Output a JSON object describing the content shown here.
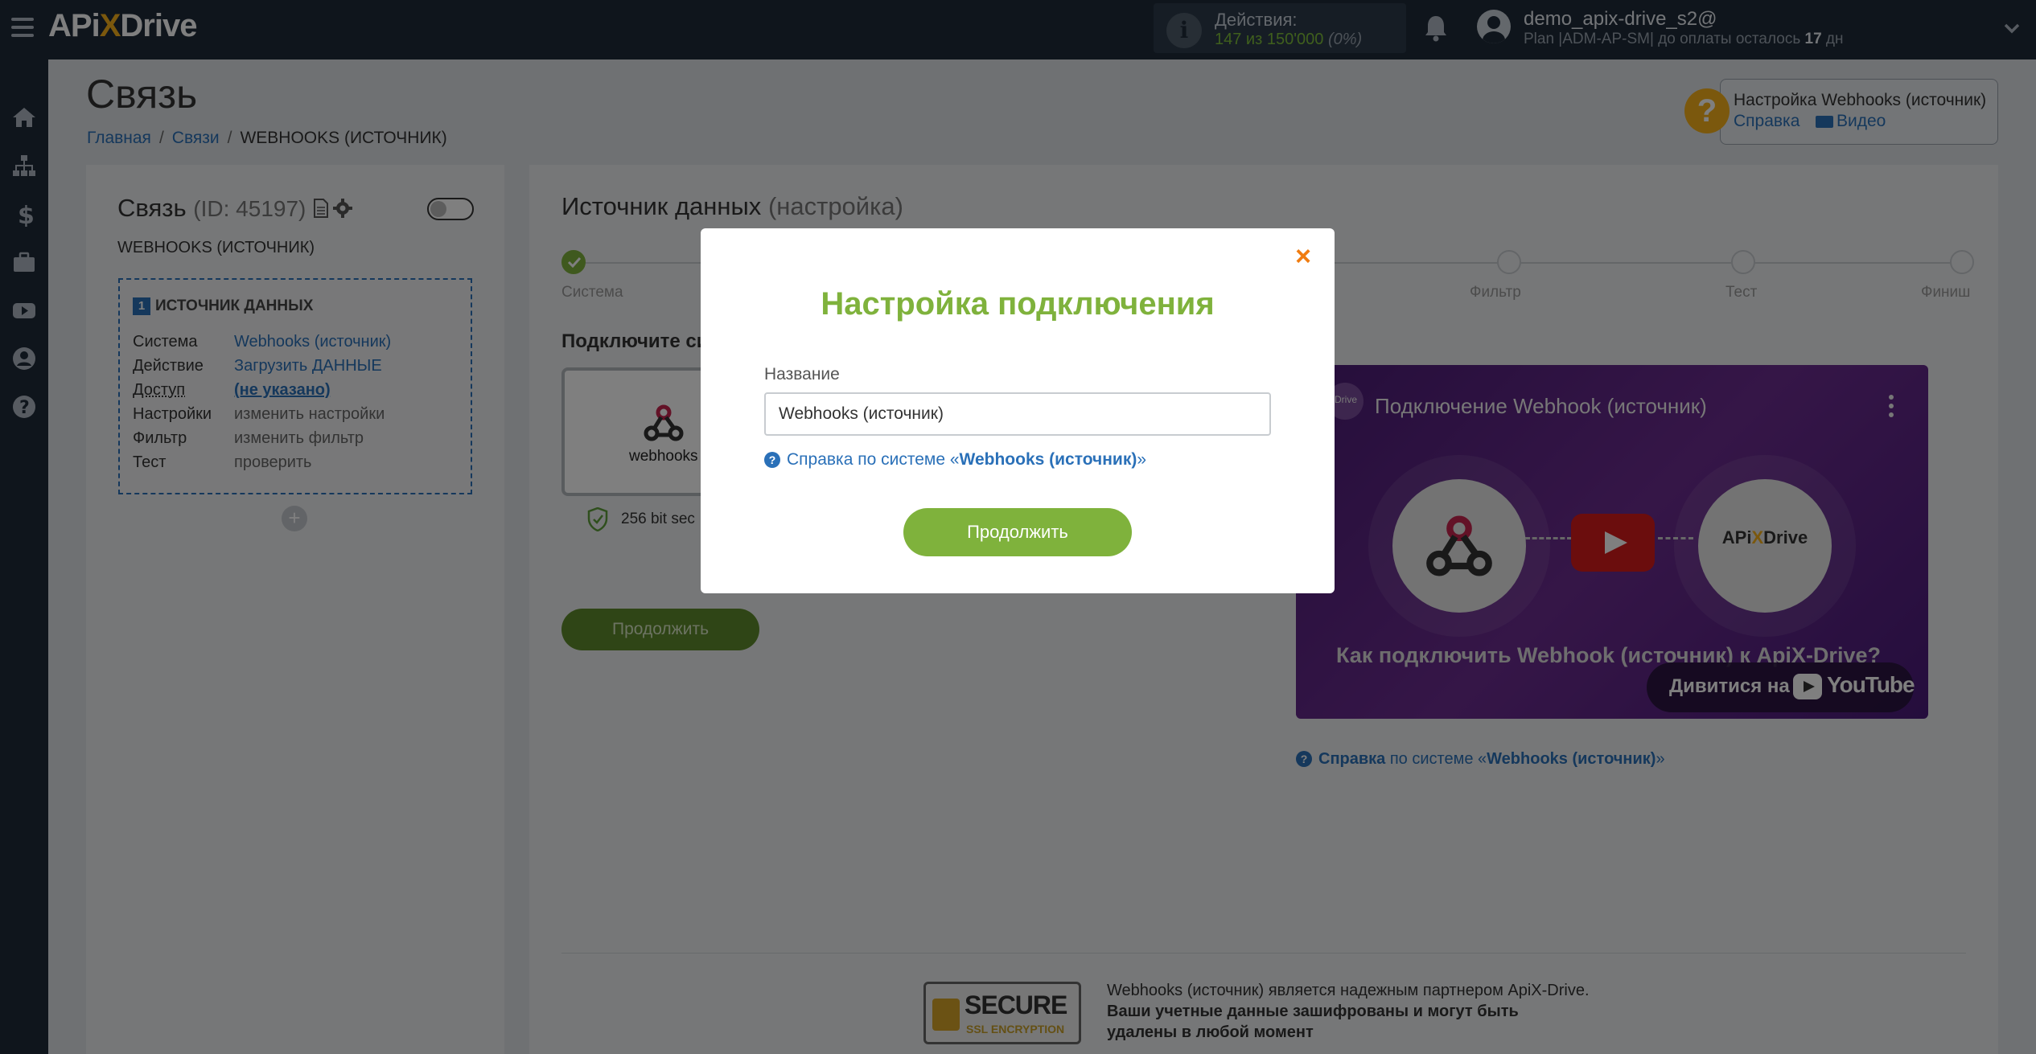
{
  "app": {
    "logo_left": "APi",
    "logo_x": "X",
    "logo_right": "Drive"
  },
  "header": {
    "actions_label": "Действия:",
    "actions_used": "147",
    "actions_mid": " из ",
    "actions_total": "150'000",
    "actions_percent": "(0%)",
    "user_name": "demo_apix-drive_s2@",
    "plan_prefix": "Plan |ADM-AP-SM| до оплаты осталось ",
    "plan_days": "17",
    "plan_suffix": " дн"
  },
  "sidebar": {
    "icons": [
      "home-icon",
      "sitemap-icon",
      "dollar-icon",
      "briefcase-icon",
      "youtube-icon",
      "user-icon",
      "question-icon"
    ]
  },
  "page": {
    "title": "Связь",
    "breadcrumb": {
      "home": "Главная",
      "links": "Связи",
      "current": "WEBHOOKS (ИСТОЧНИК)"
    },
    "help": {
      "title": "Настройка Webhooks (источник)",
      "ref": "Справка",
      "video": "Видео"
    }
  },
  "connection": {
    "title": "Связь",
    "id": "(ID: 45197)",
    "subtitle": "WEBHOOKS (ИСТОЧНИК)",
    "source": {
      "number": "1",
      "heading": "ИСТОЧНИК ДАННЫХ",
      "rows": [
        {
          "key": "Система",
          "value": "Webhooks (источник)"
        },
        {
          "key": "Действие",
          "value": "Загрузить ДАННЫЕ"
        },
        {
          "key": "Доступ",
          "value": "(не указано)"
        },
        {
          "key": "Настройки",
          "value": "изменить настройки"
        },
        {
          "key": "Фильтр",
          "value": "изменить фильтр"
        },
        {
          "key": "Тест",
          "value": "проверить"
        }
      ]
    },
    "add_symbol": "+"
  },
  "main": {
    "title": "Источник данных",
    "title_suffix": "(настройка)",
    "steps": [
      {
        "label": "Система",
        "done": true
      },
      {
        "label": "Фильтр",
        "done": false
      },
      {
        "label": "Тест",
        "done": false
      },
      {
        "label": "Финиш",
        "done": false
      }
    ],
    "connect_label": "Подключите си",
    "service_name": "webhooks",
    "ssl_text": "256 bit sec",
    "continue_label": "Продолжить",
    "video": {
      "title": "Подключение Webhook (источник)",
      "channel_logo_text": "Drive",
      "apix_logo": "APiXDrive",
      "how_text": "Как подключить Webhook (источник) к ApiX-Drive?",
      "watch_on": "Дивитися на",
      "youtube": "YouTube"
    },
    "video_help": {
      "ref": "Справка",
      "mid": " по системе «",
      "system": "Webhooks (источник)",
      "end": "»"
    },
    "secure": {
      "line1": "SECURE",
      "line2": "SSL ENCRYPTION"
    },
    "partner_line1": "Webhooks (источник) является надежным партнером ApiX-Drive.",
    "partner_line2": "Ваши учетные данные зашифрованы и могут быть",
    "partner_line3": "удалены в любой момент"
  },
  "modal": {
    "close": "×",
    "title": "Настройка подключения",
    "field_label": "Название",
    "field_value": "Webhooks (источник)",
    "help_prefix": "Справка по системе «",
    "help_system": "Webhooks (источник)",
    "help_suffix": "»",
    "continue_label": "Продолжить"
  },
  "colors": {
    "accent_green": "#7fb23c",
    "link_blue": "#2a70b8",
    "close_orange": "#f07c10",
    "topbar": "#1e2a38"
  }
}
